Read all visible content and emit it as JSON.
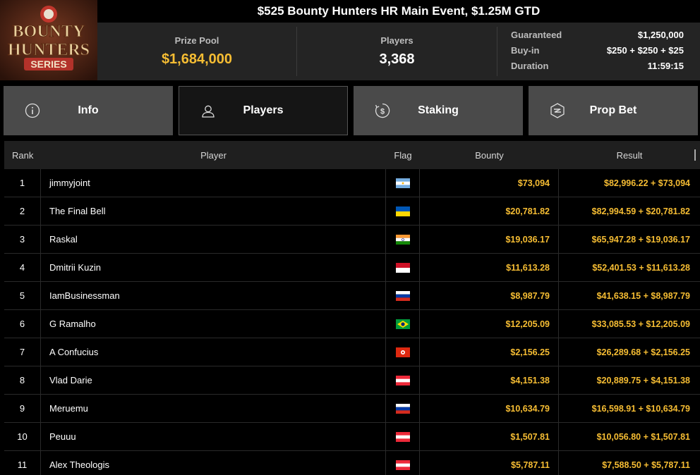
{
  "logo": {
    "line1": "BOUNTY",
    "line2": "HUNTERS",
    "line3": "SERIES"
  },
  "title": "$525 Bounty Hunters HR Main Event, $1.25M GTD",
  "stats": {
    "prize_pool_label": "Prize Pool",
    "prize_pool_value": "$1,684,000",
    "players_label": "Players",
    "players_value": "3,368"
  },
  "details": [
    {
      "label": "Guaranteed",
      "value": "$1,250,000"
    },
    {
      "label": "Buy-in",
      "value": "$250 + $250 + $25"
    },
    {
      "label": "Duration",
      "value": "11:59:15"
    }
  ],
  "tabs": [
    {
      "label": "Info",
      "icon": "info-icon",
      "active": false
    },
    {
      "label": "Players",
      "icon": "user-icon",
      "active": true
    },
    {
      "label": "Staking",
      "icon": "staking-icon",
      "active": false
    },
    {
      "label": "Prop Bet",
      "icon": "prop-bet-icon",
      "active": false
    }
  ],
  "columns": {
    "rank": "Rank",
    "player": "Player",
    "flag": "Flag",
    "bounty": "Bounty",
    "result": "Result"
  },
  "rows": [
    {
      "rank": "1",
      "player": "jimmyjoint",
      "flag": "argentina",
      "bounty": "$73,094",
      "result": "$82,996.22 + $73,094"
    },
    {
      "rank": "2",
      "player": "The Final Bell",
      "flag": "ukraine",
      "bounty": "$20,781.82",
      "result": "$82,994.59 + $20,781.82"
    },
    {
      "rank": "3",
      "player": "Raskal",
      "flag": "india",
      "bounty": "$19,036.17",
      "result": "$65,947.28 + $19,036.17"
    },
    {
      "rank": "4",
      "player": "Dmitrii Kuzin",
      "flag": "indonesia",
      "bounty": "$11,613.28",
      "result": "$52,401.53 + $11,613.28"
    },
    {
      "rank": "5",
      "player": "IamBusinessman",
      "flag": "russia",
      "bounty": "$8,987.79",
      "result": "$41,638.15 + $8,987.79"
    },
    {
      "rank": "6",
      "player": "G Ramalho",
      "flag": "brazil",
      "bounty": "$12,205.09",
      "result": "$33,085.53 + $12,205.09"
    },
    {
      "rank": "7",
      "player": "A Confucius",
      "flag": "hong-kong",
      "bounty": "$2,156.25",
      "result": "$26,289.68 + $2,156.25"
    },
    {
      "rank": "8",
      "player": "Vlad Darie",
      "flag": "austria",
      "bounty": "$4,151.38",
      "result": "$20,889.75 + $4,151.38"
    },
    {
      "rank": "9",
      "player": "Meruemu",
      "flag": "russia",
      "bounty": "$10,634.79",
      "result": "$16,598.91 + $10,634.79"
    },
    {
      "rank": "10",
      "player": "Peuuu",
      "flag": "austria",
      "bounty": "$1,507.81",
      "result": "$10,056.80 + $1,507.81"
    },
    {
      "rank": "11",
      "player": "Alex Theologis",
      "flag": "austria",
      "bounty": "$5,787.11",
      "result": "$7,588.50 + $5,787.11"
    }
  ],
  "colors": {
    "accent_gold": "#f6bd33",
    "tab_bg": "#4a4a4a",
    "header_bg": "#242424"
  }
}
